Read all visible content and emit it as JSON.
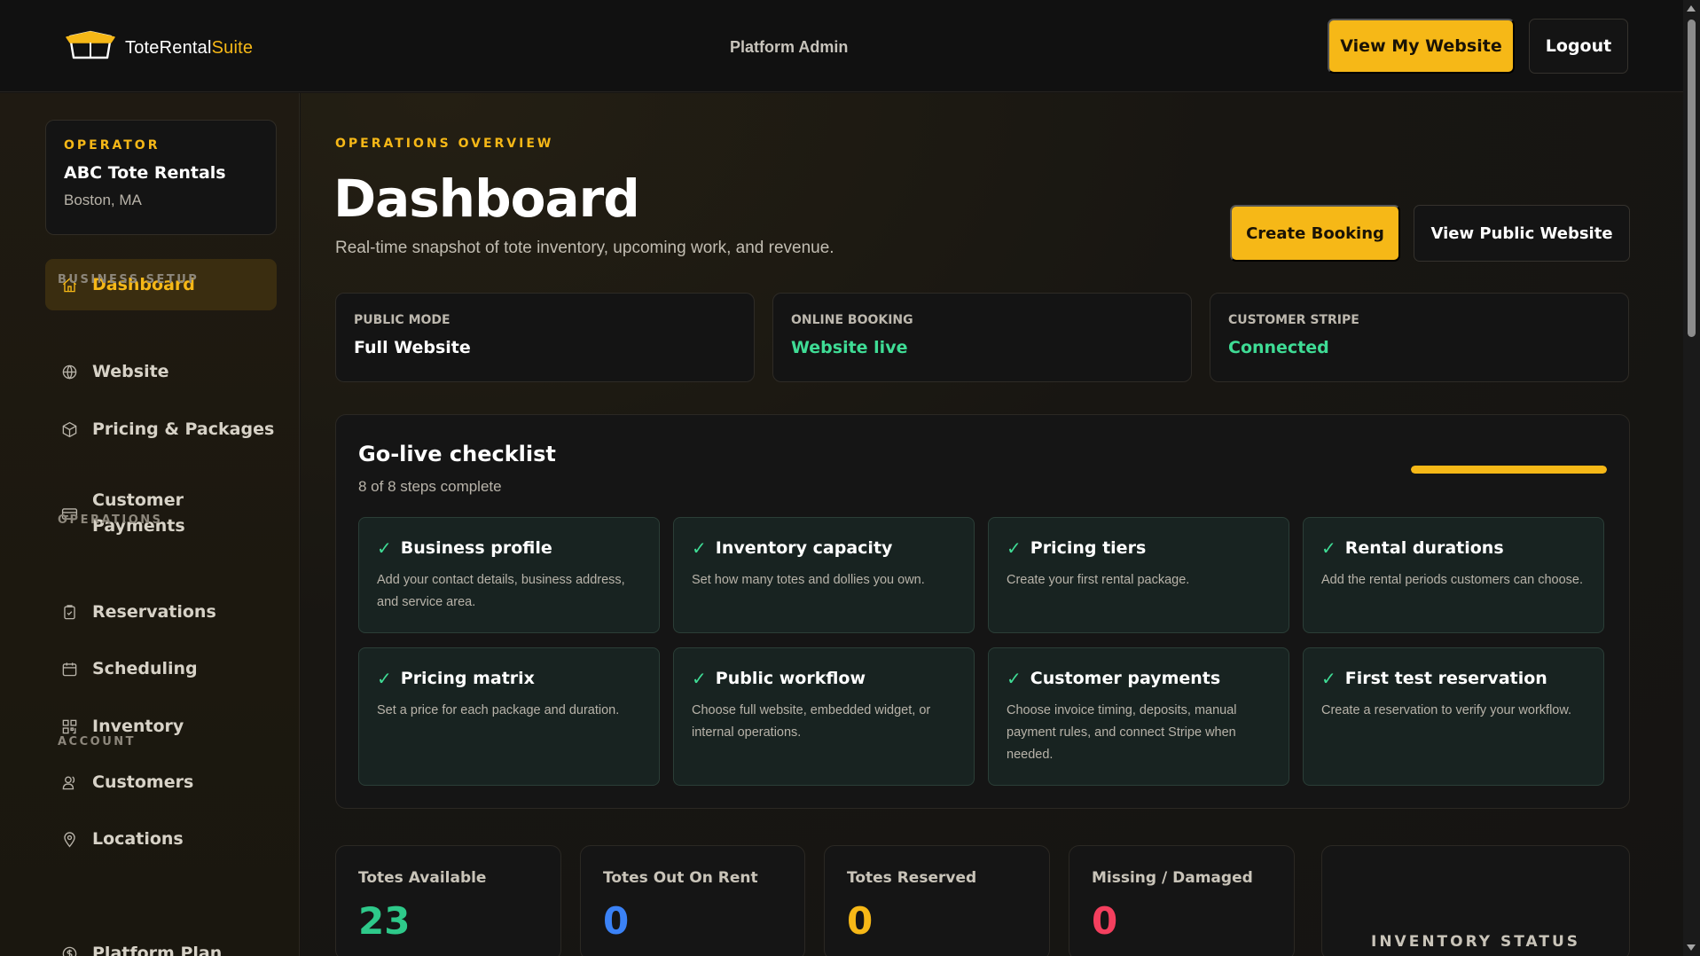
{
  "header": {
    "brand_name": "ToteRental",
    "brand_accent": "Suite",
    "role_label": "Platform Admin",
    "view_website_label": "View My Website",
    "logout_label": "Logout"
  },
  "sidebar": {
    "operator": {
      "kicker": "OPERATOR",
      "name": "ABC Tote Rentals",
      "location": "Boston, MA"
    },
    "active_item": {
      "label": "Dashboard",
      "icon": "home-icon"
    },
    "sections": [
      {
        "label": "BUSINESS SETUP",
        "items": [
          {
            "label": "Website",
            "icon": "globe-icon"
          },
          {
            "label": "Pricing & Packages",
            "icon": "package-icon"
          },
          {
            "label": "Customer Payments",
            "icon": "credit-card-icon"
          }
        ]
      },
      {
        "label": "OPERATIONS",
        "items": [
          {
            "label": "Reservations",
            "icon": "clipboard-check-icon"
          },
          {
            "label": "Scheduling",
            "icon": "calendar-icon"
          },
          {
            "label": "Inventory",
            "icon": "qr-code-icon"
          },
          {
            "label": "Customers",
            "icon": "users-icon"
          },
          {
            "label": "Locations",
            "icon": "map-pin-icon"
          }
        ]
      },
      {
        "label": "ACCOUNT",
        "items": [
          {
            "label": "Platform Plan",
            "icon": "dollar-circle-icon"
          }
        ]
      }
    ]
  },
  "main": {
    "kicker": "OPERATIONS OVERVIEW",
    "title": "Dashboard",
    "subtitle": "Real-time snapshot of tote inventory, upcoming work, and revenue.",
    "create_booking_label": "Create Booking",
    "view_public_label": "View Public Website",
    "status_cards": [
      {
        "kicker": "PUBLIC MODE",
        "value": "Full Website"
      },
      {
        "kicker": "ONLINE BOOKING",
        "value": "Website live"
      },
      {
        "kicker": "CUSTOMER STRIPE",
        "value": "Connected"
      }
    ],
    "checklist": {
      "title": "Go-live checklist",
      "subtitle": "8 of 8 steps complete",
      "progress": 1.0,
      "check_glyph": "✓",
      "steps": [
        {
          "title": "Business profile",
          "desc": "Add your contact details, business address, and service area."
        },
        {
          "title": "Inventory capacity",
          "desc": "Set how many totes and dollies you own."
        },
        {
          "title": "Pricing tiers",
          "desc": "Create your first rental package."
        },
        {
          "title": "Rental durations",
          "desc": "Add the rental periods customers can choose."
        },
        {
          "title": "Pricing matrix",
          "desc": "Set a price for each package and duration."
        },
        {
          "title": "Public workflow",
          "desc": "Choose full website, embedded widget, or internal operations."
        },
        {
          "title": "Customer payments",
          "desc": "Choose invoice timing, deposits, manual payment rules, and connect Stripe when needed."
        },
        {
          "title": "First test reservation",
          "desc": "Create a reservation to verify your workflow."
        }
      ]
    },
    "metrics": [
      {
        "label": "Totes Available",
        "value": "23",
        "color": "#2ec98a"
      },
      {
        "label": "Totes Out On Rent",
        "value": "0",
        "color": "#3b82f6"
      },
      {
        "label": "Totes Reserved",
        "value": "0",
        "color": "#f6b817"
      },
      {
        "label": "Missing / Damaged",
        "value": "0",
        "color": "#f43f5e"
      }
    ],
    "inventory_status_label": "INVENTORY STATUS"
  },
  "colors": {
    "accent": "#f6b817",
    "success": "#3fdc95",
    "background": "#161412"
  }
}
